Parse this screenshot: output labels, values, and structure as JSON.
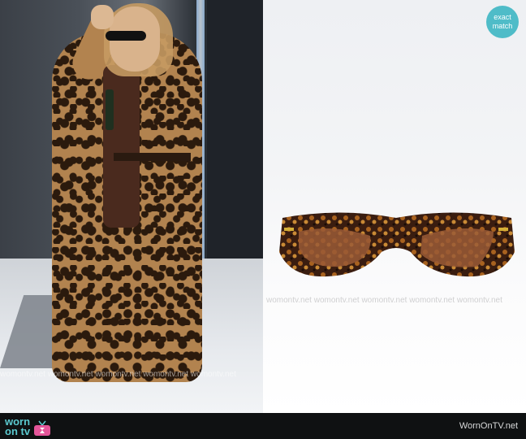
{
  "badge": {
    "line1": "exact",
    "line2": "match",
    "color": "#4fbcc8"
  },
  "watermark": "womontv.net  womontv.net  womontv.net  womontv.net  womontv.net",
  "footer": {
    "logo_line1": "worn",
    "logo_line2": "on tv",
    "logo_color": "#5bc9cf",
    "site_name": "WornOnTV.net"
  },
  "icons": {
    "logo": "tv-icon"
  }
}
